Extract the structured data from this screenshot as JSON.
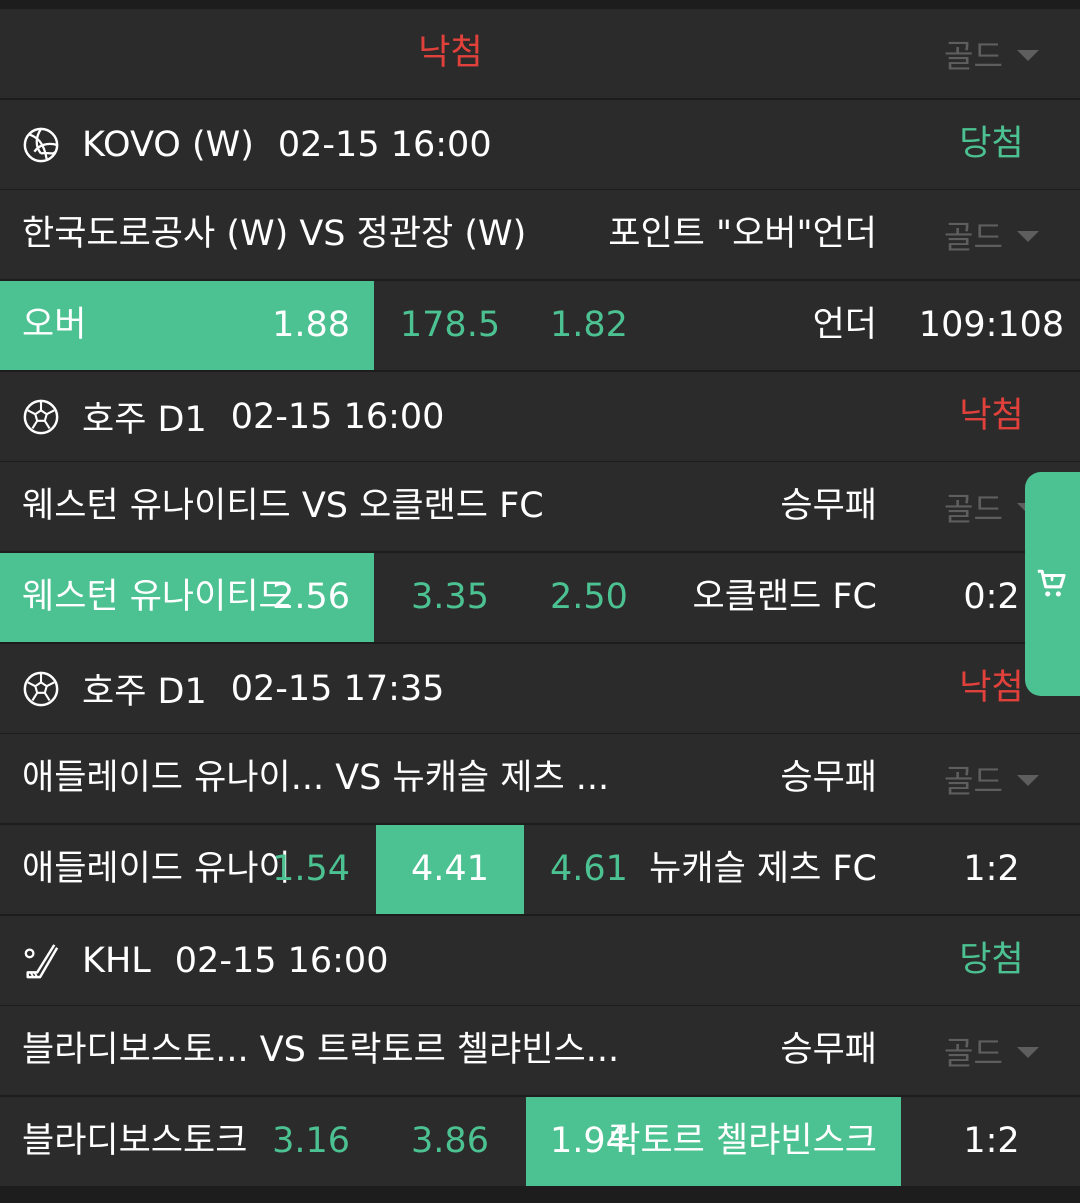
{
  "colors": {
    "accent": "#4cc191",
    "lose": "#e2413b",
    "win": "#4cc191",
    "muted": "#5e5e5e",
    "row_bg": "#2b2b2b"
  },
  "top": {
    "result": "낙첨",
    "gold": "골드"
  },
  "bets": [
    {
      "sport_icon": "volleyball-icon",
      "league": "KOVO (W)",
      "datetime": "02-15 16:00",
      "result": "당첨",
      "match": "한국도로공사 (W) VS 정관장 (W)",
      "market": "포인트 \"오버\"언더",
      "gold": "골드",
      "home_label": "오버",
      "home_odd": "1.88",
      "draw_value": "178.5",
      "away_odd": "1.82",
      "away_label": "언더",
      "score": "109:108"
    },
    {
      "sport_icon": "soccer-ball-icon",
      "league": "호주 D1",
      "datetime": "02-15 16:00",
      "result": "낙첨",
      "match": "웨스턴 유나이티드 VS 오클랜드 FC",
      "market": "승무패",
      "gold": "골드",
      "home_label": "웨스턴 유나이티드",
      "home_odd": "2.56",
      "draw_value": "3.35",
      "away_odd": "2.50",
      "away_label": "오클랜드 FC",
      "score": "0:2"
    },
    {
      "sport_icon": "soccer-ball-icon",
      "league": "호주 D1",
      "datetime": "02-15 17:35",
      "result": "낙첨",
      "match": "애들레이드 유나이... VS 뉴캐슬 제츠 ...",
      "market": "승무패",
      "gold": "골드",
      "home_label": "애들레이드 유나이",
      "home_odd": "1.54",
      "draw_value": "4.41",
      "away_odd": "4.61",
      "away_label": "뉴캐슬 제츠 FC",
      "score": "1:2"
    },
    {
      "sport_icon": "hockey-stick-icon",
      "league": "KHL",
      "datetime": "02-15 16:00",
      "result": "당첨",
      "match": "블라디보스토... VS 트락토르 첼랴빈스...",
      "market": "승무패",
      "gold": "골드",
      "home_label": "블라디보스토크",
      "home_odd": "3.16",
      "draw_value": "3.86",
      "away_odd": "1.94",
      "away_label": "락토르 첼랴빈스크",
      "score": "1:2"
    }
  ],
  "cart": {
    "icon": "shopping-cart-icon"
  }
}
